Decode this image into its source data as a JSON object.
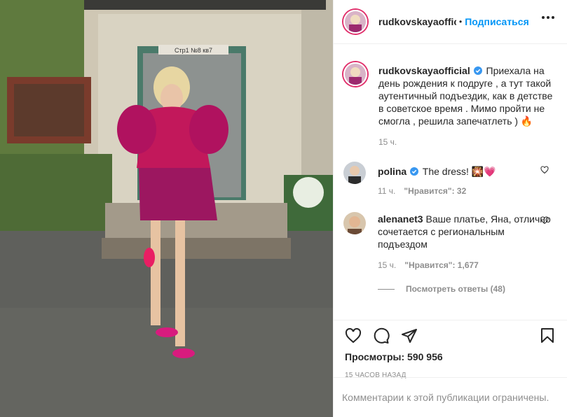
{
  "header": {
    "username": "rudkovskayaofficial",
    "separator": "•",
    "follow_label": "Подписаться"
  },
  "caption": {
    "username": "rudkovskayaofficial",
    "text": "Приехала на день рождения к подруге , а тут такой аутентичный подъездик, как в детстве в советское время . Мимо пройти не смогла , решила запечатлеть ) 🔥",
    "time": "15 ч."
  },
  "comments": [
    {
      "username": "polina",
      "verified": true,
      "text": "The dress! 🎇💗",
      "time": "11 ч.",
      "likes": "\"Нравится\": 32"
    },
    {
      "username": "alenanet3",
      "verified": false,
      "text": "Ваше платье, Яна, отлично сочетается с региональным подъездом",
      "time": "15 ч.",
      "likes": "\"Нравится\": 1,677",
      "replies": "Посмотреть ответы (48)"
    }
  ],
  "actions": {
    "views": "Просмотры: 590 956",
    "posted": "15 ЧАСОВ НАЗАД",
    "comments_limited": "Комментарии к этой публикации ограничены."
  },
  "media": {
    "door_sign": "Стр1 №8 кв7"
  },
  "colors": {
    "accent": "#0095f6",
    "muted": "#8e8e8e",
    "text": "#262626"
  },
  "icons": [
    "heart-icon",
    "comment-icon",
    "share-icon",
    "bookmark-icon",
    "verified-icon",
    "more-options-icon"
  ]
}
